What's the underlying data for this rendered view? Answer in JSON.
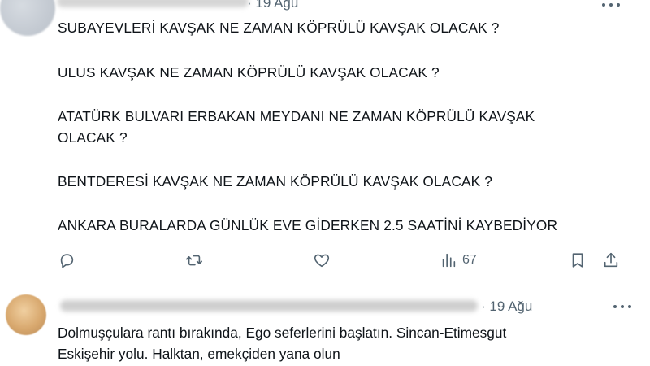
{
  "tweet1": {
    "author": "",
    "date": "· 19 Ağu",
    "lines": [
      "SUBAYEVLERİ KAVŞAK NE ZAMAN KÖPRÜLÜ KAVŞAK OLACAK ?",
      "ULUS KAVŞAK NE ZAMAN KÖPRÜLÜ KAVŞAK OLACAK ?",
      "ATATÜRK BULVARI ERBAKAN MEYDANI NE ZAMAN KÖPRÜLÜ KAVŞAK",
      "OLACAK ?",
      "BENTDERESİ KAVŞAK NE ZAMAN KÖPRÜLÜ KAVŞAK OLACAK ?",
      "ANKARA BURALARDA GÜNLÜK EVE GİDERKEN 2.5 SAATİNİ KAYBEDİYOR"
    ],
    "actions": {
      "reply_icon": "reply-icon",
      "retweet_icon": "retweet-icon",
      "like_icon": "heart-icon",
      "views_icon": "views-chart-icon",
      "views_count": "67",
      "bookmark_icon": "bookmark-icon",
      "share_icon": "share-icon"
    }
  },
  "tweet2": {
    "author": "",
    "date": "· 19 Ağu",
    "lines": [
      "Dolmuşçulara rantı bırakında, Ego seferlerini başlatın. Sincan-Etimesgut",
      "Eskişehir yolu. Halktan, emekçiden yana olun"
    ]
  },
  "colors": {
    "text": "#0f1419",
    "secondary": "#536471",
    "divider": "#eff3f4"
  }
}
